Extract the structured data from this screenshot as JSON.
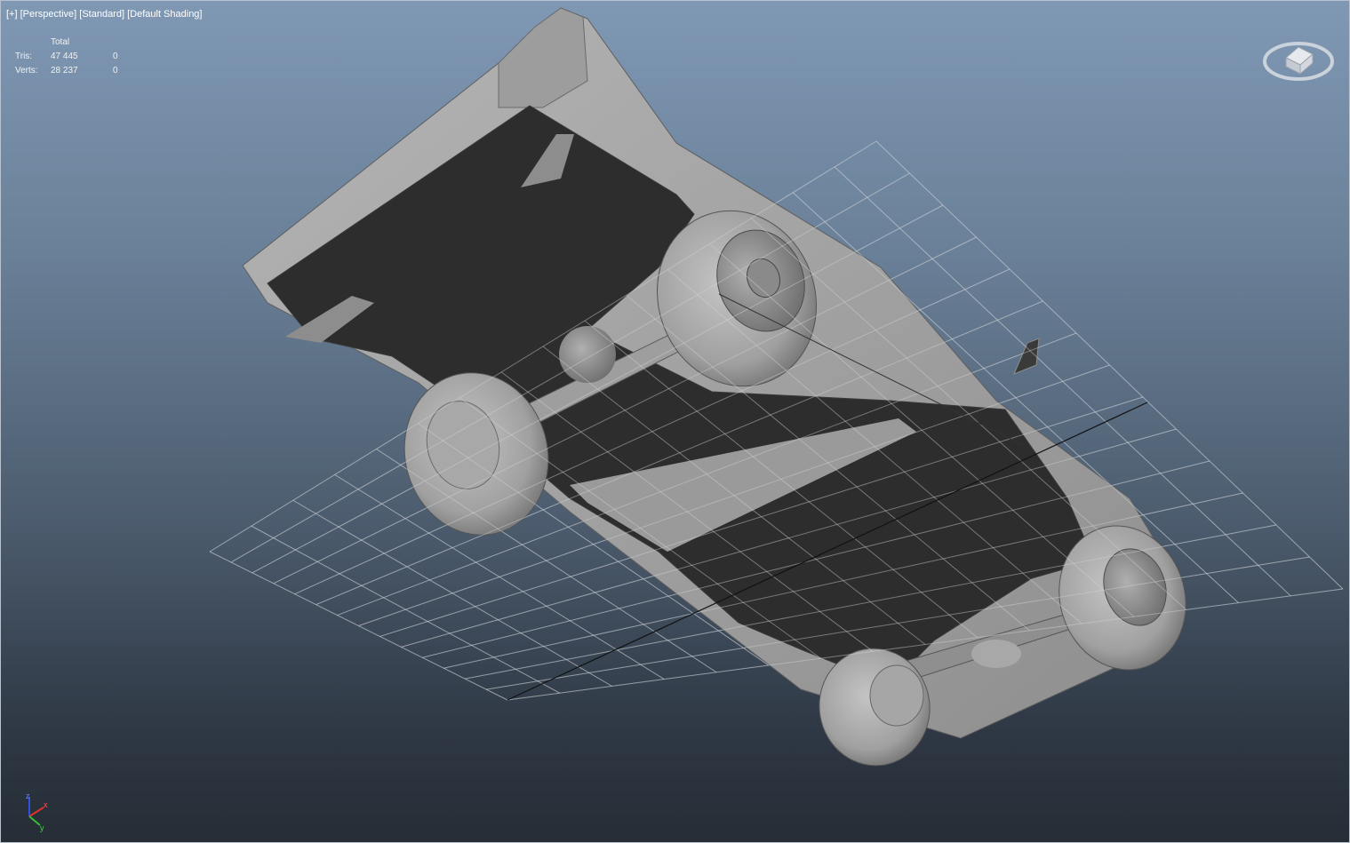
{
  "viewport": {
    "menu_plus": "[+]",
    "view_mode": "[Perspective]",
    "view_style": "[Standard]",
    "shading": "[Default Shading]"
  },
  "stats": {
    "header": "Total",
    "rows": [
      {
        "label": "Tris:",
        "total": "47 445",
        "selected": "0"
      },
      {
        "label": "Verts:",
        "total": "28 237",
        "selected": "0"
      }
    ]
  },
  "axis_tripod": {
    "x": "x",
    "y": "y",
    "z": "z"
  },
  "colors": {
    "viewport_top": "#7f98b4",
    "viewport_bottom": "#262d36",
    "model_body": "#a3a3a3",
    "model_underside": "#2b2b2b",
    "grid_line": "#c8ccd2",
    "axis_x": "#e03030",
    "axis_y": "#30c030",
    "axis_z": "#3050e0"
  },
  "icons": {
    "viewcube": "viewcube-icon",
    "axis": "axis-tripod-icon"
  }
}
